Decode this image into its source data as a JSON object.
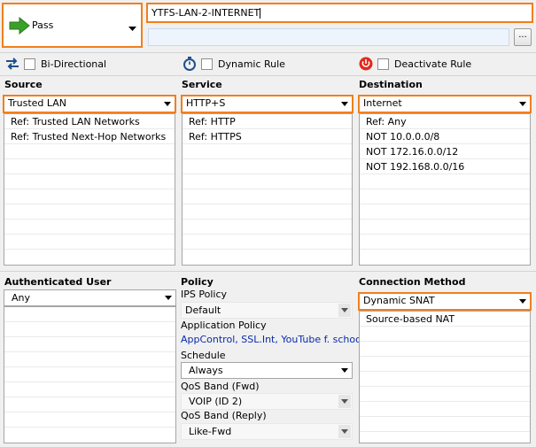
{
  "rule": {
    "action": "Pass",
    "name": "YTFS-LAN-2-INTERNET",
    "comment": "",
    "browse_label": "..."
  },
  "options": {
    "bidirectional": "Bi-Directional",
    "dynamic_rule": "Dynamic Rule",
    "deactivate_rule": "Deactivate Rule"
  },
  "source": {
    "title": "Source",
    "selected": "Trusted  LAN",
    "items": [
      "Ref: Trusted LAN Networks",
      "Ref: Trusted Next-Hop Networks"
    ]
  },
  "service": {
    "title": "Service",
    "selected": "HTTP+S",
    "items": [
      "Ref: HTTP",
      "Ref: HTTPS"
    ]
  },
  "destination": {
    "title": "Destination",
    "selected": "Internet",
    "items": [
      "Ref: Any",
      "NOT 10.0.0.0/8",
      "NOT 172.16.0.0/12",
      "NOT 192.168.0.0/16"
    ]
  },
  "auth_user": {
    "title": "Authenticated User",
    "selected": "Any"
  },
  "policy": {
    "title": "Policy",
    "ips_label": "IPS Policy",
    "ips_value": "Default",
    "app_label": "Application Policy",
    "app_value": "AppControl, SSL.Int, YouTube f. schools",
    "schedule_label": "Schedule",
    "schedule_value": "Always",
    "qos_fwd_label": "QoS Band (Fwd)",
    "qos_fwd_value": "VOIP (ID 2)",
    "qos_reply_label": "QoS Band (Reply)",
    "qos_reply_value": "Like-Fwd"
  },
  "connection": {
    "title": "Connection Method",
    "selected": "Dynamic SNAT",
    "items": [
      "Source-based NAT"
    ]
  },
  "colors": {
    "highlight": "#f07f1e",
    "pass_arrow": "#3aa02a",
    "link": "#0a2aa8"
  },
  "icons": {
    "action": "green-arrow-right-icon",
    "bidirectional": "swap-arrows-icon",
    "dynamic": "stopwatch-icon",
    "deactivate": "power-icon"
  }
}
